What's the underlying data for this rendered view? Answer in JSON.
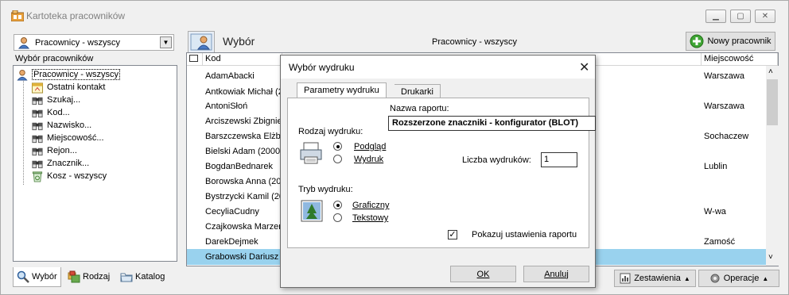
{
  "window": {
    "title": "Kartoteka pracowników"
  },
  "left": {
    "combo_value": "Pracownicy - wszyscy",
    "caption": "Wybór pracowników",
    "tree": [
      "Pracownicy - wszyscy",
      "Ostatni kontakt",
      "Szukaj...",
      "Kod...",
      "Nazwisko...",
      "Miejscowość...",
      "Rejon...",
      "Znacznik...",
      "Kosz - wszyscy"
    ],
    "tabs": [
      "Wybór",
      "Rodzaj",
      "Katalog"
    ]
  },
  "right": {
    "title": "Wybór",
    "subtitle": "Pracownicy - wszyscy",
    "new_button": "Nowy pracownik",
    "columns": {
      "kod": "Kod",
      "miejscowosc": "Miejscowość"
    },
    "rows": [
      {
        "kod": "AdamAbacki",
        "miasto": "Warszawa"
      },
      {
        "kod": "Antkowiak Michał (2",
        "miasto": ""
      },
      {
        "kod": "AntoniSłoń",
        "miasto": "Warszawa"
      },
      {
        "kod": "Arciszewski Zbignie",
        "miasto": ""
      },
      {
        "kod": "Barszczewska Elżbi",
        "miasto": "Sochaczew"
      },
      {
        "kod": "Bielski Adam (20003",
        "miasto": ""
      },
      {
        "kod": "BogdanBednarek",
        "miasto": "Lublin"
      },
      {
        "kod": "Borowska Anna (200",
        "miasto": ""
      },
      {
        "kod": "Bystrzycki Kamil (20",
        "miasto": ""
      },
      {
        "kod": "CecyliaCudny",
        "miasto": "W-wa"
      },
      {
        "kod": "Czajkowska Marzen",
        "miasto": ""
      },
      {
        "kod": "DarekDejmek",
        "miasto": "Zamość"
      },
      {
        "kod": "Grabowski Dariusz (",
        "miasto": ""
      }
    ],
    "zestawienia": "Zestawienia",
    "operacje": "Operacje"
  },
  "dialog": {
    "title": "Wybór wydruku",
    "tabs": [
      "Parametry wydruku",
      "Drukarki"
    ],
    "report_label": "Nazwa raportu:",
    "report_value": "Rozszerzone znaczniki - konfigurator (BLOT)",
    "rodzaj_label": "Rodzaj wydruku:",
    "podglad": "Podgląd",
    "wydruk": "Wydruk",
    "liczba_label": "Liczba wydruków:",
    "liczba_value": "1",
    "tryb_label": "Tryb wydruku:",
    "graficzny": "Graficzny",
    "tekstowy": "Tekstowy",
    "pokazuj": "Pokazuj ustawienia raportu",
    "ok": "OK",
    "anuluj": "Anuluj"
  },
  "colors": {
    "selection": "#99d2ee",
    "accent_green": "#3fa535"
  }
}
